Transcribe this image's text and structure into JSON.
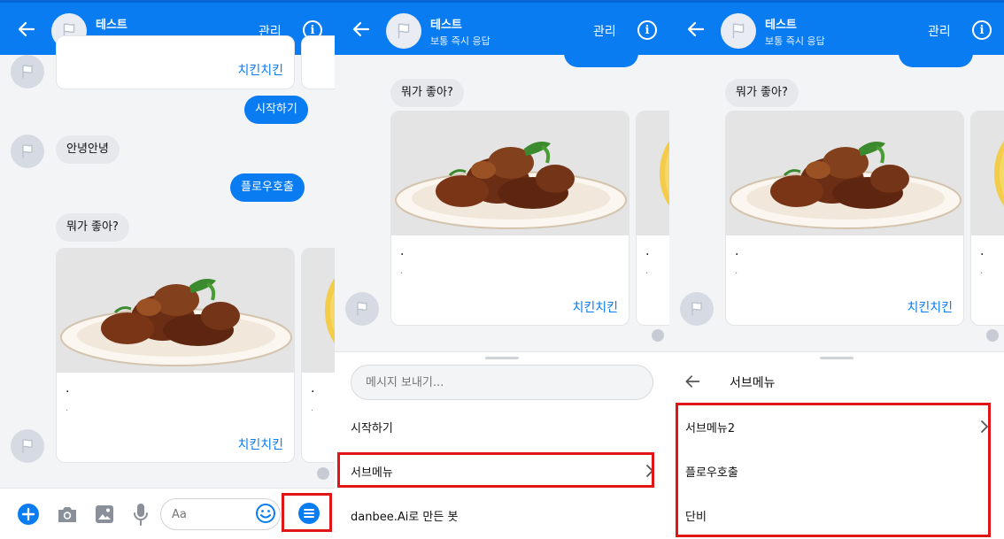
{
  "chat": {
    "title": "테스트",
    "subtitle": "보통 즉시 응답",
    "manage": "관리",
    "info": "i"
  },
  "messages": {
    "card_button": "치킨치킨",
    "start": "시작하기",
    "hello": "안녕안녕",
    "flow_call": "플로우호출",
    "question": "뭐가 좋아?",
    "card_title": ".",
    "card_desc": "."
  },
  "composer": {
    "placeholder": "메시지 보내기...",
    "aa_placeholder": "Aa"
  },
  "menu": {
    "items": [
      "시작하기",
      "서브메뉴",
      "danbee.Ai로 만든 봇"
    ]
  },
  "submenu": {
    "title": "서브메뉴",
    "items": [
      "서브메뉴2",
      "플로우호출",
      "단비"
    ]
  },
  "icons": {
    "back": "arrow-left-icon",
    "info": "info-circle-icon",
    "avatar": "flag-icon",
    "chevron": "chevron-right-icon",
    "plus": "plus-circle-icon",
    "camera": "camera-icon",
    "image": "image-icon",
    "mic": "microphone-icon",
    "emoji": "emoji-icon",
    "menu": "menu-list-icon"
  },
  "colors": {
    "brand": "#0a7cf2",
    "highlight": "#e01515",
    "link": "#0a7cf2"
  }
}
